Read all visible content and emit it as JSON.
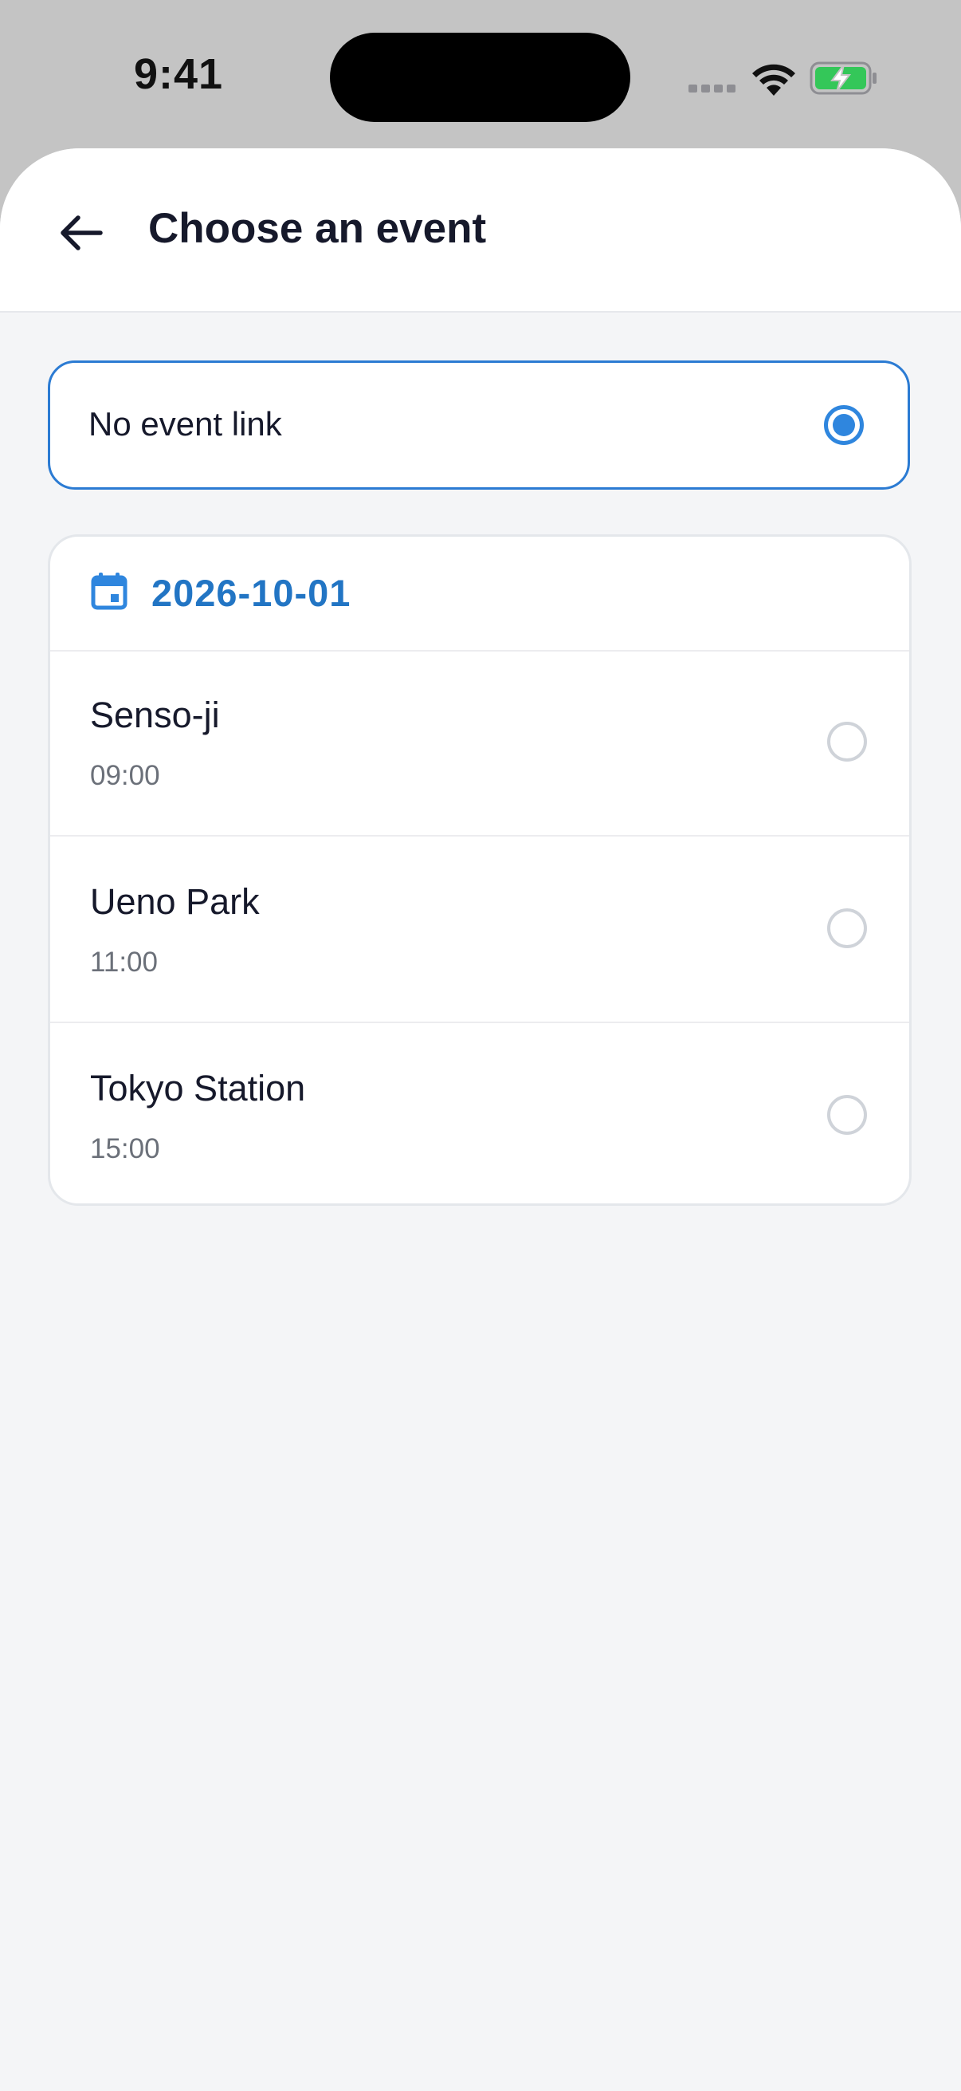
{
  "status_bar": {
    "time": "9:41",
    "icons": [
      "signal-icon",
      "wifi-icon",
      "battery-charging-icon"
    ]
  },
  "header": {
    "back_icon": "arrow-left-icon",
    "title": "Choose an event"
  },
  "no_event_option": {
    "label": "No event link",
    "selected": true
  },
  "event_group": {
    "date_icon": "calendar-icon",
    "date": "2026-10-01",
    "events": [
      {
        "name": "Senso-ji",
        "time": "09:00",
        "selected": false
      },
      {
        "name": "Ueno Park",
        "time": "11:00",
        "selected": false
      },
      {
        "name": "Tokyo Station",
        "time": "15:00",
        "selected": false
      }
    ]
  },
  "colors": {
    "accent": "#2f86de",
    "date_text": "#2275c4",
    "title_text": "#16192b",
    "secondary_text": "#6b7079",
    "battery_green": "#34c759"
  }
}
